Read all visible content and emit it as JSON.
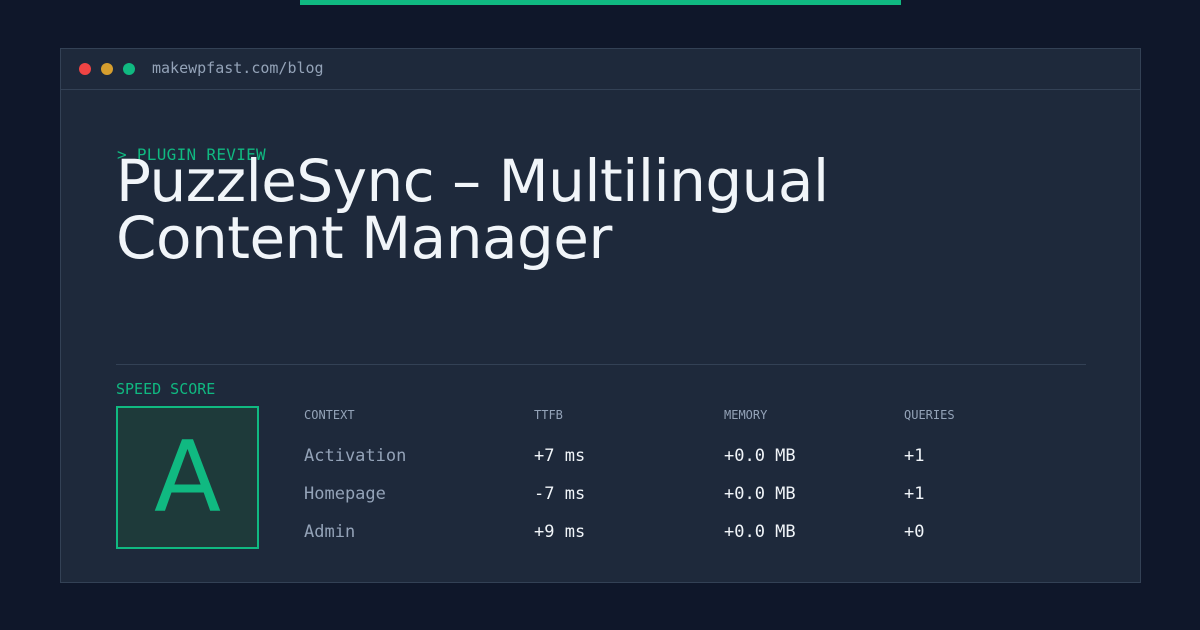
{
  "window": {
    "url": "makewpfast.com/blog"
  },
  "header": {
    "kicker": "> PLUGIN REVIEW",
    "title": "PuzzleSync – Multilingual Content Manager"
  },
  "score": {
    "label": "SPEED SCORE",
    "grade": "A"
  },
  "metrics": {
    "columns": [
      "CONTEXT",
      "TTFB",
      "MEMORY",
      "QUERIES"
    ],
    "rows": [
      {
        "context": "Activation",
        "ttfb": "+7 ms",
        "memory": "+0.0 MB",
        "queries": "+1"
      },
      {
        "context": "Homepage",
        "ttfb": "-7 ms",
        "memory": "+0.0 MB",
        "queries": "+1"
      },
      {
        "context": "Admin",
        "ttfb": "+9 ms",
        "memory": "+0.0 MB",
        "queries": "+0"
      }
    ]
  },
  "colors": {
    "background": "#0f172a",
    "panel": "#1e293b",
    "accent": "#10b981",
    "text": "#f1f5f9",
    "muted": "#94a3b8"
  }
}
